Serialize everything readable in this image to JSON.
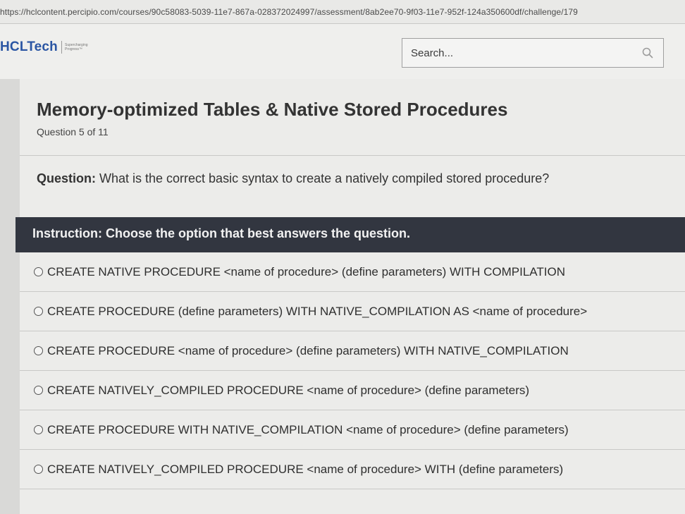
{
  "browser": {
    "url": "https://hclcontent.percipio.com/courses/90c58083-5039-11e7-867a-028372024997/assessment/8ab2ee70-9f03-11e7-952f-124a350600df/challenge/179"
  },
  "header": {
    "logo_text": "HCLTech",
    "logo_tagline": "Supercharging Progress™",
    "search_placeholder": "Search..."
  },
  "assessment": {
    "title": "Memory-optimized Tables & Native Stored Procedures",
    "counter": "Question 5 of 11",
    "question_label": "Question:",
    "question_text": " What is the correct basic syntax to create a natively compiled stored procedure?",
    "instruction": "Instruction: Choose the option that best answers the question.",
    "options": [
      {
        "label": "CREATE NATIVE PROCEDURE <name of procedure> (define parameters) WITH COMPILATION"
      },
      {
        "label": "CREATE PROCEDURE (define parameters) WITH NATIVE_COMPILATION AS <name of procedure>"
      },
      {
        "label": "CREATE PROCEDURE <name of procedure> (define parameters) WITH NATIVE_COMPILATION"
      },
      {
        "label": "CREATE NATIVELY_COMPILED PROCEDURE <name of procedure> (define parameters)"
      },
      {
        "label": "CREATE PROCEDURE WITH NATIVE_COMPILATION <name of procedure> (define parameters)"
      },
      {
        "label": "CREATE NATIVELY_COMPILED PROCEDURE <name of procedure> WITH (define parameters)"
      }
    ]
  },
  "colors": {
    "brand_blue": "#2a55a3",
    "instruction_bg": "#323640",
    "page_bg": "#ececea"
  }
}
